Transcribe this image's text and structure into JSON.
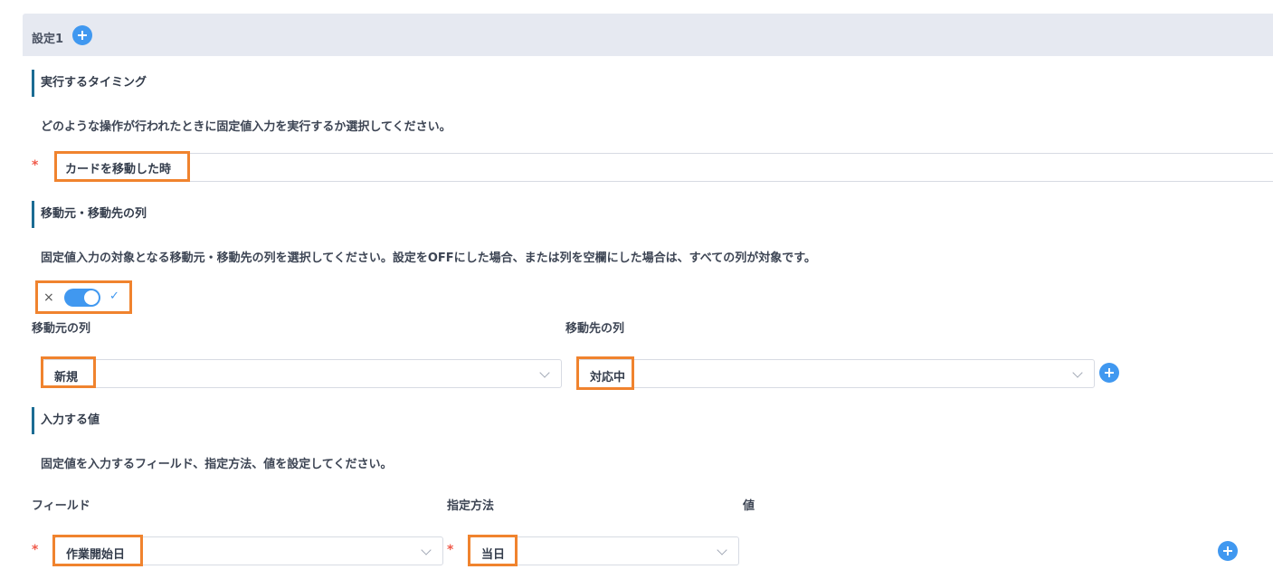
{
  "header": {
    "title": "設定1"
  },
  "timing": {
    "title": "実行するタイミング",
    "desc": "どのような操作が行われたときに固定値入力を実行するか選択してください。",
    "required_mark": "*",
    "value": "カードを移動した時"
  },
  "columns": {
    "title": "移動元・移動先の列",
    "desc": "固定値入力の対象となる移動元・移動先の列を選択してください。設定をOFFにした場合、または列を空欄にした場合は、すべての列が対象です。",
    "toggle": {
      "off_icon": "×",
      "on_icon": "✓",
      "state": "on"
    },
    "source_label": "移動元の列",
    "source_value": "新規",
    "dest_label": "移動先の列",
    "dest_value": "対応中"
  },
  "values": {
    "title": "入力する値",
    "desc": "固定値を入力するフィールド、指定方法、値を設定してください。",
    "field_label": "フィールド",
    "method_label": "指定方法",
    "value_label": "値",
    "required_mark": "*",
    "field_value": "作業開始日",
    "method_value": "当日"
  },
  "colors": {
    "accent": "#4098f0",
    "highlight": "#f0832e",
    "required": "#f05a4a",
    "section_bar": "#1b6c93",
    "header_bg": "#e6e9f1"
  },
  "icons": {
    "add": "plus-circle-icon",
    "dropdown": "chevron-down-icon"
  }
}
